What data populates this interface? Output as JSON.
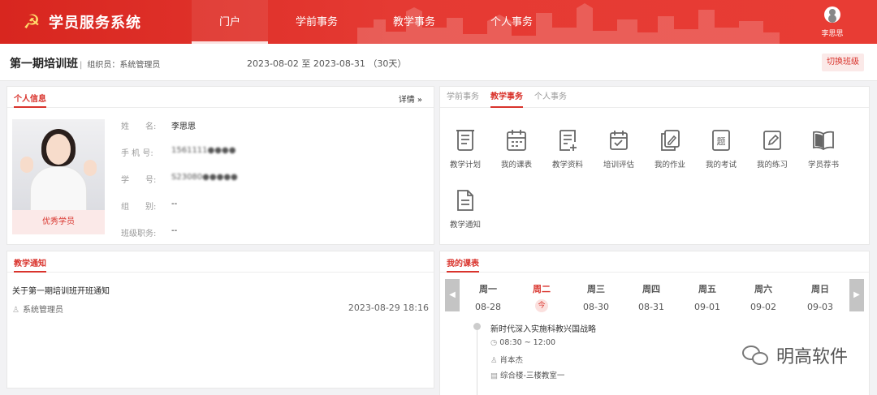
{
  "app": {
    "title": "学员服务系统",
    "emblem": "☭"
  },
  "nav": {
    "items": [
      "门户",
      "学前事务",
      "教学事务",
      "个人事务"
    ],
    "active": "门户"
  },
  "user": {
    "name": "李思思"
  },
  "class": {
    "name": "第一期培训班",
    "organizer": "组织员：系统管理员",
    "dates": "2023-08-02 至 2023-08-31 （30天）",
    "switch_label": "切换班级"
  },
  "profile": {
    "title": "个人信息",
    "more": "详情 »",
    "badge": "优秀学员",
    "rows": [
      {
        "label": "姓　　名:",
        "value": "李思思"
      },
      {
        "label": "手 机 号:",
        "value": "1561111●●●●"
      },
      {
        "label": "学　　号:",
        "value": "S23080●●●●●"
      },
      {
        "label": "组　　别:",
        "value": "--"
      },
      {
        "label": "班级职务:",
        "value": "--"
      }
    ]
  },
  "services": {
    "tabs": [
      "学前事务",
      "教学事务",
      "个人事务"
    ],
    "active_tab": "教学事务",
    "items": [
      {
        "label": "教学计划",
        "icon": "scroll-icon"
      },
      {
        "label": "我的课表",
        "icon": "calendar-icon"
      },
      {
        "label": "教学资料",
        "icon": "document-add-icon"
      },
      {
        "label": "培训评估",
        "icon": "calendar-check-icon"
      },
      {
        "label": "我的作业",
        "icon": "edit-copy-icon"
      },
      {
        "label": "我的考试",
        "icon": "exam-icon"
      },
      {
        "label": "我的练习",
        "icon": "pencil-square-icon"
      },
      {
        "label": "学员荐书",
        "icon": "book-icon"
      },
      {
        "label": "教学通知",
        "icon": "file-text-icon"
      }
    ]
  },
  "notice": {
    "title": "教学通知",
    "items": [
      {
        "title": "关于第一期培训班开班通知",
        "author": "系统管理员",
        "time": "2023-08-29 18:16"
      }
    ]
  },
  "schedule": {
    "title": "我的课表",
    "days": [
      {
        "name": "周一",
        "date": "08-28"
      },
      {
        "name": "周二",
        "date": "今",
        "today": true
      },
      {
        "name": "周三",
        "date": "08-30"
      },
      {
        "name": "周四",
        "date": "08-31"
      },
      {
        "name": "周五",
        "date": "09-01"
      },
      {
        "name": "周六",
        "date": "09-02"
      },
      {
        "name": "周日",
        "date": "09-03"
      }
    ],
    "course": {
      "title": "新时代深入实施科教兴国战略",
      "time": "08:30 ~ 12:00",
      "teacher": "肖本杰",
      "location": "综合楼-三楼教室一"
    }
  },
  "watermark": {
    "text": "明高软件"
  },
  "colors": {
    "primary": "#d9332c",
    "header": "#e53a33",
    "light": "#fbe9e8"
  }
}
